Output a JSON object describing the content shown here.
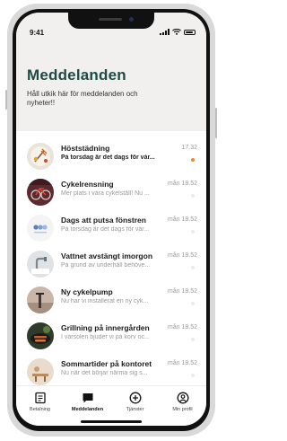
{
  "status_bar": {
    "time": "9:41"
  },
  "header": {
    "title": "Meddelanden",
    "subtitle": "Håll utkik här för meddelanden och nyheter!!"
  },
  "messages": [
    {
      "title": "Höststädning",
      "preview": "På torsdag är det dags för vår...",
      "time": "17.32",
      "unread": true,
      "avatar_icon": "leaf-rake-icon"
    },
    {
      "title": "Cykelrensning",
      "preview": "Mer plats i våra cykelställ! Nu ...",
      "time": "mån 18.52",
      "unread": false,
      "avatar_icon": "bicycle-icon"
    },
    {
      "title": "Dags att putsa fönstren",
      "preview": "På torsdag är det dags för vår...",
      "time": "mån 18.52",
      "unread": false,
      "avatar_icon": "window-cleaning-icon"
    },
    {
      "title": "Vattnet avstängt imorgon",
      "preview": "På grund av underhåll behöve...",
      "time": "mån 18.52",
      "unread": false,
      "avatar_icon": "water-tap-icon"
    },
    {
      "title": "Ny cykelpump",
      "preview": "Nu har vi installerat en ny cyk...",
      "time": "mån 18.52",
      "unread": false,
      "avatar_icon": "bike-pump-icon"
    },
    {
      "title": "Grillning på innergården",
      "preview": "I vårsolen bjuder vi på korv oc...",
      "time": "mån 18.52",
      "unread": false,
      "avatar_icon": "grill-icon"
    },
    {
      "title": "Sommartider på kontoret",
      "preview": "Nu när det börjar närma sig s...",
      "time": "mån 18.52",
      "unread": false,
      "avatar_icon": "office-icon"
    }
  ],
  "tabbar": {
    "tabs": [
      {
        "label": "Betalning",
        "icon": "receipt-icon",
        "active": false
      },
      {
        "label": "Meddelanden",
        "icon": "message-icon",
        "active": true
      },
      {
        "label": "Tjänster",
        "icon": "plus-circle-icon",
        "active": false
      },
      {
        "label": "Min profil",
        "icon": "profile-icon",
        "active": false
      }
    ]
  },
  "colors": {
    "title": "#1f4a44",
    "unread_dot": "#f08a2a",
    "header_bg": "#f1f0ee"
  }
}
